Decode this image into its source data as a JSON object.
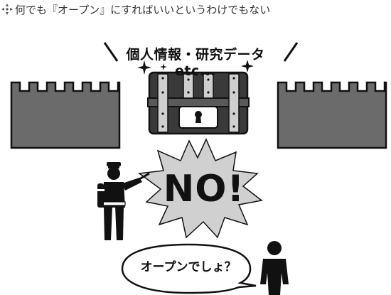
{
  "header": {
    "icon": "four-diamond-arrow-icon",
    "title": "何でも『オープン』にすればいいというわけでもない"
  },
  "treasure_label": "個人情報・研究データ etc...",
  "shout_text": "NO!",
  "speech_text": "オープンでしょ？",
  "colors": {
    "wall_fill": "#6b6b6b",
    "chest_fill": "#3a3a3a",
    "burst_fill": "#d0d0d0",
    "figure_fill": "#111111"
  }
}
